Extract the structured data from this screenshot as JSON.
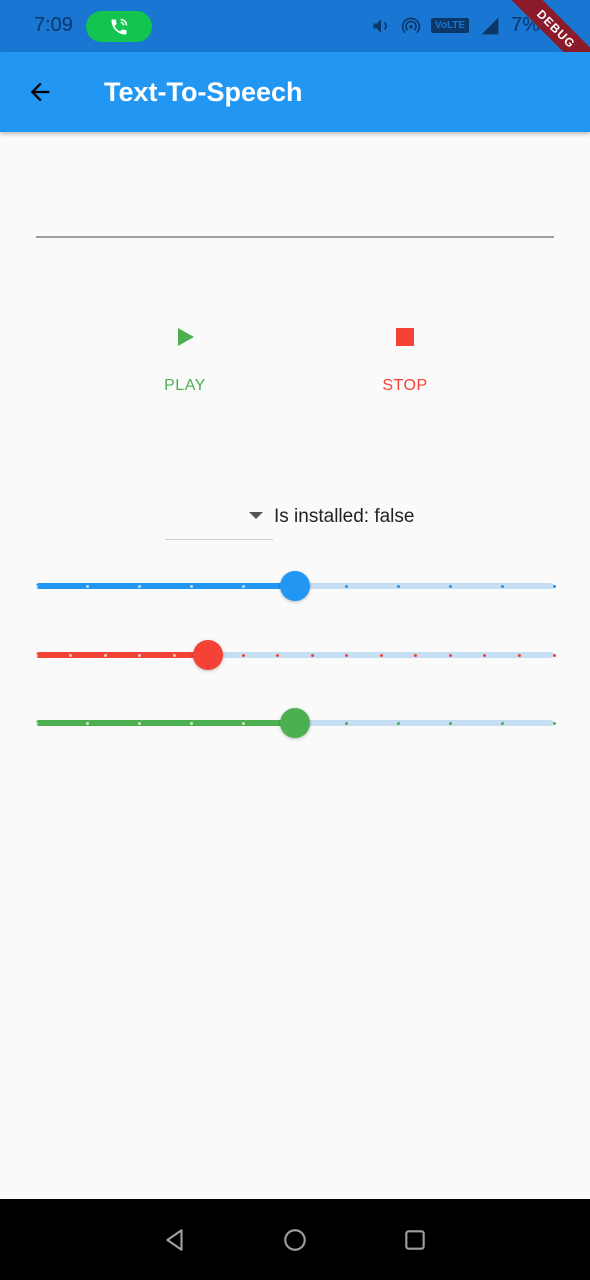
{
  "status_bar": {
    "time": "7:09",
    "battery": "7%",
    "volte": "VoLTE"
  },
  "debug_banner": "DEBUG",
  "app_bar": {
    "title": "Text-To-Speech"
  },
  "text_field": {
    "value": "",
    "placeholder": ""
  },
  "buttons": {
    "play": "PLAY",
    "stop": "STOP"
  },
  "dropdown": {
    "selected": ""
  },
  "engine_status": "Is installed: false",
  "sliders": [
    {
      "id": "volume",
      "value": 0.5,
      "divisions": 10,
      "color": "#2196f3"
    },
    {
      "id": "pitch",
      "value": 0.333,
      "divisions": 15,
      "color": "#f44336"
    },
    {
      "id": "rate",
      "value": 0.5,
      "divisions": 10,
      "color": "#4caf50"
    }
  ],
  "colors": {
    "app_bar": "#2196f3",
    "status_bar": "#1976d2",
    "play": "#4caf50",
    "stop": "#f44336"
  }
}
